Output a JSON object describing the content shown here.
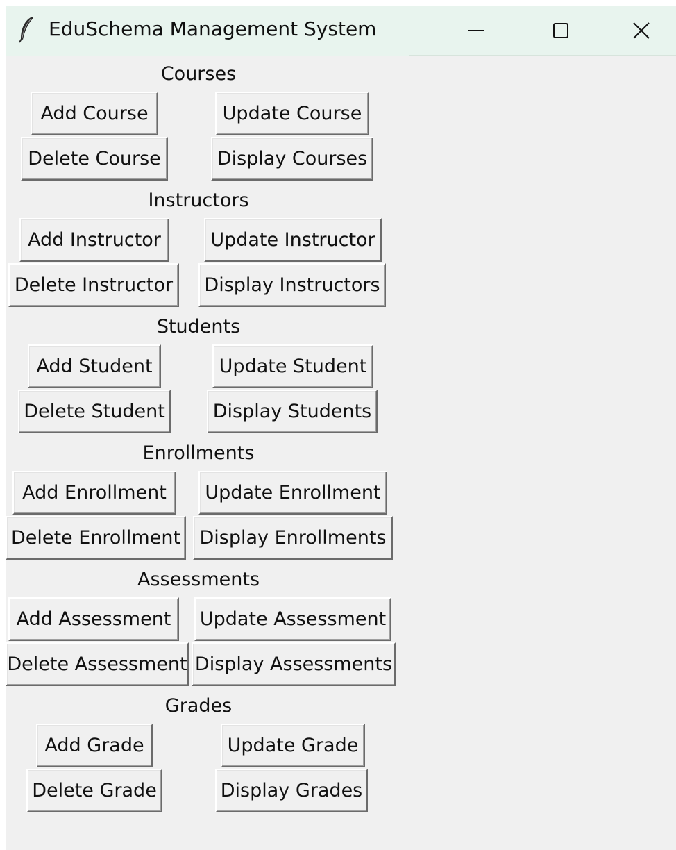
{
  "window": {
    "title": "EduSchema Management System",
    "title_bar_color": "#e8f4ee",
    "background_color": "#f0f0f0",
    "controls": {
      "minimize_icon": "minimize-icon",
      "maximize_icon": "maximize-icon",
      "close_icon": "close-icon"
    }
  },
  "sections": [
    {
      "title": "Courses",
      "add": "Add Course",
      "update": "Update Course",
      "delete": "Delete Course",
      "display": "Display Courses"
    },
    {
      "title": "Instructors",
      "add": "Add Instructor",
      "update": "Update Instructor",
      "delete": "Delete Instructor",
      "display": "Display Instructors"
    },
    {
      "title": "Students",
      "add": "Add Student",
      "update": "Update Student",
      "delete": "Delete Student",
      "display": "Display Students"
    },
    {
      "title": "Enrollments",
      "add": "Add Enrollment",
      "update": "Update Enrollment",
      "delete": "Delete Enrollment",
      "display": "Display Enrollments"
    },
    {
      "title": "Assessments",
      "add": "Add Assessment",
      "update": "Update Assessment",
      "delete": "Delete Assessment",
      "display": "Display Assessments"
    },
    {
      "title": "Grades",
      "add": "Add Grade",
      "update": "Update Grade",
      "delete": "Delete Grade",
      "display": "Display Grades"
    }
  ]
}
